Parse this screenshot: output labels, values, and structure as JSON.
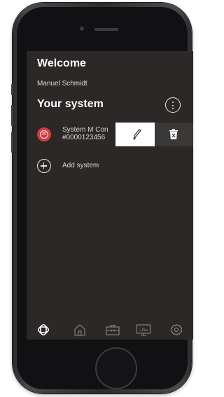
{
  "screen": {
    "welcome_label": "Welcome",
    "user_name": "Manuel Schmidt",
    "section_title": "Your system",
    "more_icon": "more-vertical-icon"
  },
  "systems": [
    {
      "name": "System M Con",
      "serial": "#0000123456",
      "icon": "thermostat-icon",
      "icon_color": "#d9393e",
      "actions": {
        "edit_icon": "pencil-icon",
        "delete_icon": "trash-icon"
      }
    }
  ],
  "add_system": {
    "label": "Add system",
    "icon": "plus-circle-icon"
  },
  "tabbar": {
    "items": [
      {
        "icon": "logo-icon",
        "active": true
      },
      {
        "icon": "home-icon",
        "active": false
      },
      {
        "icon": "toolbox-icon",
        "active": false
      },
      {
        "icon": "statistics-icon",
        "active": false
      },
      {
        "icon": "settings-icon",
        "active": false
      }
    ]
  },
  "colors": {
    "screen_bg": "#2b2827",
    "accent_red": "#d9393e",
    "icon_inactive": "#8a8785",
    "text": "#ffffff"
  }
}
